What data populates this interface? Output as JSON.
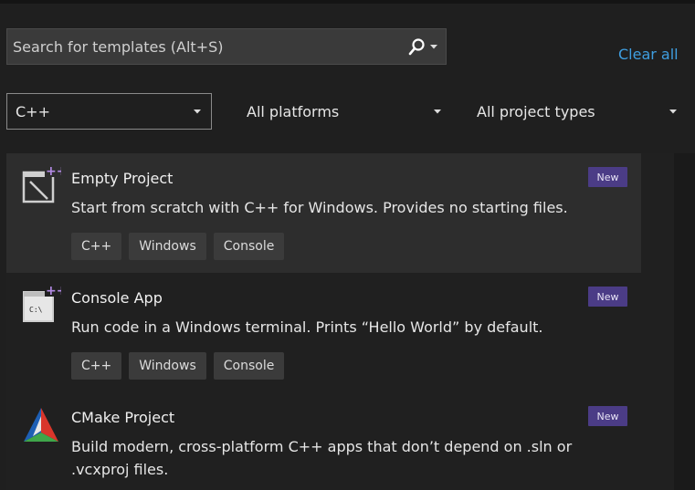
{
  "search": {
    "placeholder": "Search for templates (Alt+S)"
  },
  "clear_all_label": "Clear all",
  "filters": {
    "language": "C++",
    "platform": "All platforms",
    "project_type": "All project types"
  },
  "templates": [
    {
      "title": "Empty Project",
      "description": "Start from scratch with C++ for Windows. Provides no starting files.",
      "badge": "New",
      "tags": [
        "C++",
        "Windows",
        "Console"
      ],
      "icon": "empty-project-icon"
    },
    {
      "title": "Console App",
      "description": "Run code in a Windows terminal. Prints “Hello World” by default.",
      "badge": "New",
      "tags": [
        "C++",
        "Windows",
        "Console"
      ],
      "icon": "console-app-icon"
    },
    {
      "title": "CMake Project",
      "description": "Build modern, cross-platform C++ apps that don’t depend on .sln or .vcxproj files.",
      "badge": "New",
      "tags": [],
      "icon": "cmake-icon"
    }
  ],
  "console_icon_text": "C:\\",
  "colors": {
    "accent_link": "#3f9ee0",
    "badge_bg": "#4b3c86",
    "selected_bg": "#2d2d2d"
  }
}
